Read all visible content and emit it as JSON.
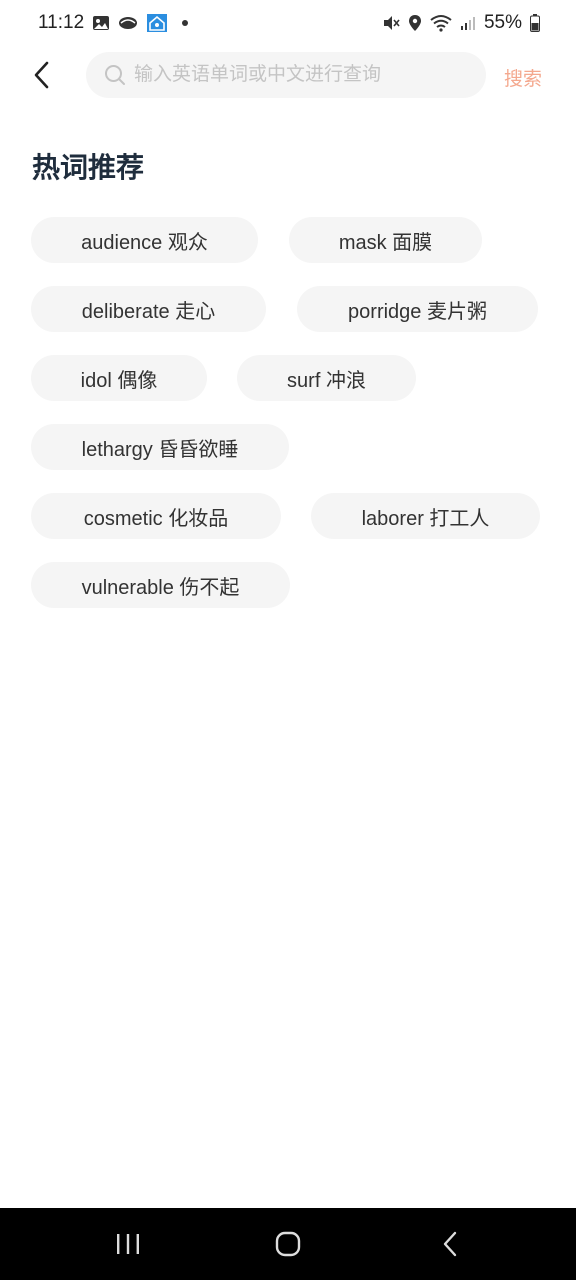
{
  "status_bar": {
    "time": "11:12",
    "battery": "55%"
  },
  "search": {
    "placeholder": "输入英语单词或中文进行查询",
    "button_label": "搜索"
  },
  "section": {
    "title": "热词推荐"
  },
  "hot_words": [
    {
      "label": "audience 观众"
    },
    {
      "label": "mask 面膜"
    },
    {
      "label": "deliberate 走心"
    },
    {
      "label": "porridge 麦片粥"
    },
    {
      "label": "idol 偶像"
    },
    {
      "label": "surf 冲浪"
    },
    {
      "label": "lethargy 昏昏欲睡"
    },
    {
      "label": "cosmetic 化妆品"
    },
    {
      "label": "laborer 打工人"
    },
    {
      "label": "vulnerable 伤不起"
    }
  ],
  "colors": {
    "accent": "#f4a88e",
    "title": "#1f2d3d",
    "chip_bg": "#f5f5f5",
    "search_bg": "#f5f5f5"
  }
}
